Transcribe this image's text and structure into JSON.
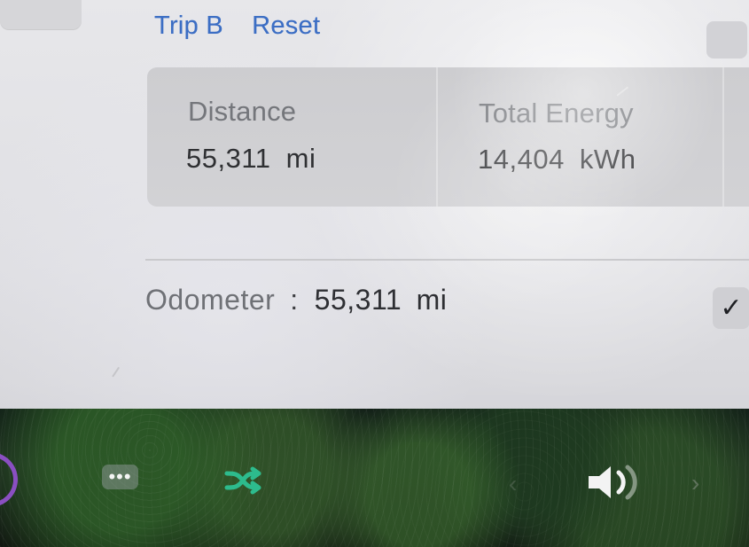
{
  "header": {
    "trip_label": "Trip B",
    "reset_label": "Reset"
  },
  "stats": [
    {
      "label": "Distance",
      "value": "55,311 mi"
    },
    {
      "label": "Total Energy",
      "value": "14,404 kWh"
    }
  ],
  "odometer": {
    "label": "Odometer",
    "separator": ":",
    "value": "55,311 mi"
  },
  "taskbar": {
    "more_label": "•••"
  },
  "colors": {
    "accent": "#3c6ec4",
    "shuffle_icon": "#2dbb8d",
    "app_circle": "#8a4fc1"
  },
  "icons": {
    "check": "check-icon",
    "shuffle": "shuffle-icon",
    "volume": "volume-icon",
    "left_chevron": "left-chevron-icon",
    "right_chevron": "right-chevron-icon",
    "app": "app-circle-icon"
  }
}
